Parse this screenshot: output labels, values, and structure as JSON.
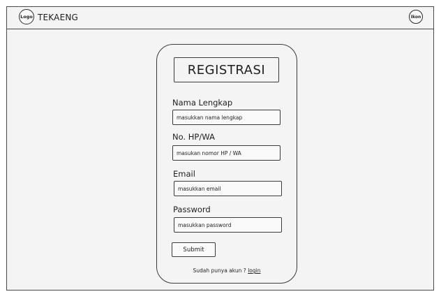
{
  "header": {
    "logo_text": "Logo",
    "brand": "TEKAENG",
    "icon_text": "Ikon"
  },
  "form": {
    "title": "REGISTRASI",
    "fields": [
      {
        "label": "Nama Lengkap",
        "placeholder": "masukkan nama lengkap",
        "value": ""
      },
      {
        "label": "No. HP/WA",
        "placeholder": "masukan nomor HP / WA",
        "value": ""
      },
      {
        "label": "Email",
        "placeholder": "masukkan email",
        "value": ""
      },
      {
        "label": "Password",
        "placeholder": "masukkan password",
        "value": ""
      }
    ],
    "submit_label": "Submit",
    "footer_prompt": "Sudah punya akun ?",
    "login_link": "login"
  }
}
